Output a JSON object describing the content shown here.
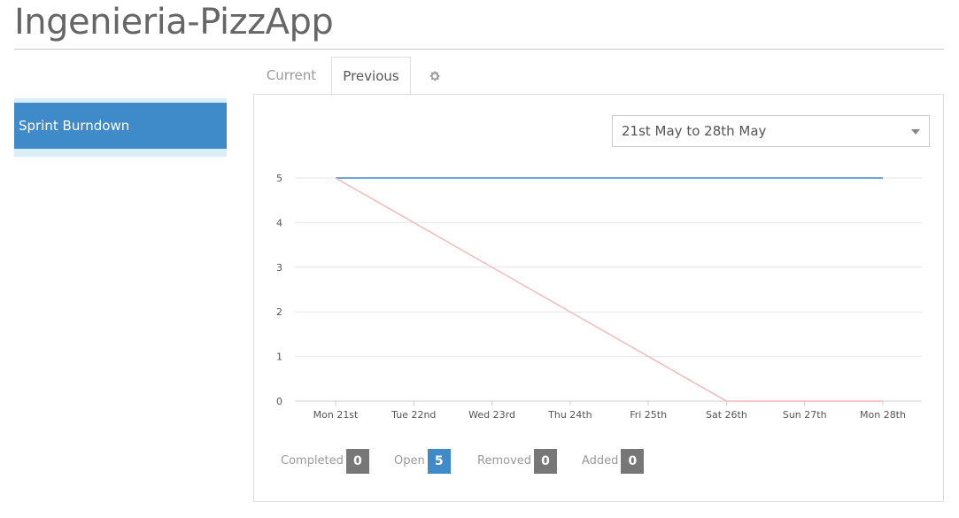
{
  "app": {
    "title": "Ingenieria-PizzApp"
  },
  "sidebar": {
    "items": [
      {
        "label": "Sprint Burndown"
      }
    ]
  },
  "tabs": [
    {
      "label": "Current"
    },
    {
      "label": "Previous"
    },
    {
      "label": "",
      "icon": "gear-icon"
    }
  ],
  "range": {
    "selected": "21st May to 28th May"
  },
  "colors": {
    "accent": "#3f8ac9",
    "ideal": "#f4b6b6",
    "badge_grey": "#777777"
  },
  "chart_data": {
    "type": "line",
    "categories": [
      "Mon 21st",
      "Tue 22nd",
      "Wed 23rd",
      "Thu 24th",
      "Fri 25th",
      "Sat 26th",
      "Sun 27th",
      "Mon 28th"
    ],
    "series": [
      {
        "values": [
          5,
          5,
          5,
          5,
          5,
          5,
          5,
          5
        ],
        "color": "#3f8ac9"
      },
      {
        "values": [
          5,
          4,
          3,
          2,
          1,
          0,
          0,
          0
        ],
        "color": "#f4b6b6"
      }
    ],
    "ylim": [
      0,
      5
    ],
    "yticks": [
      0,
      1,
      2,
      3,
      4,
      5
    ],
    "grid": true
  },
  "stats": [
    {
      "label": "Completed",
      "value": "0"
    },
    {
      "label": "Open",
      "value": "5"
    },
    {
      "label": "Removed",
      "value": "0"
    },
    {
      "label": "Added",
      "value": "0"
    }
  ]
}
